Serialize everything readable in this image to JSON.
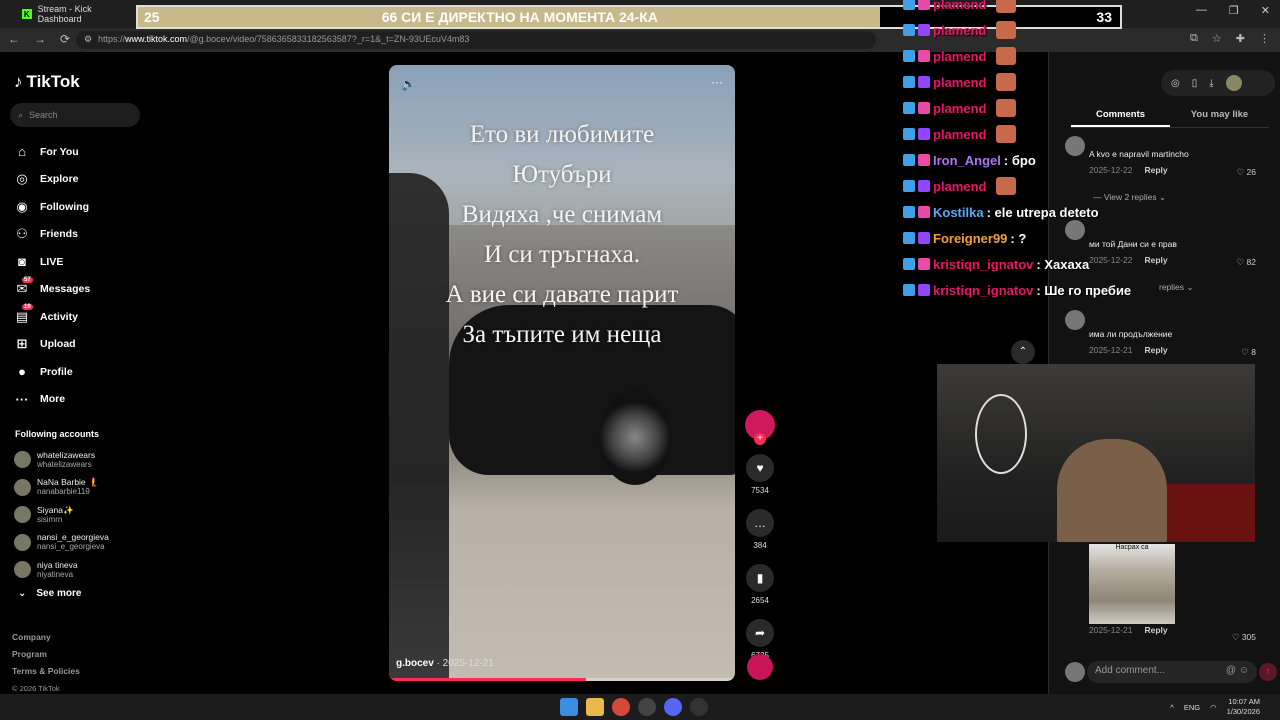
{
  "browser": {
    "tab_title": "Stream - Kick Dashboard",
    "url_host": "www.tiktok.com",
    "url_rest": "/@g.bocev/video/7586365833182563587?_r=1&_t=ZN-93UEcuV4m83",
    "url_scheme": "https://"
  },
  "banner": {
    "left_number": "25",
    "text": "66 СИ Е ДИРЕКТНО НА МОМЕНТА 24-КА",
    "right_number": "33"
  },
  "tiktok": {
    "logo": "TikTok",
    "search_placeholder": "Search",
    "nav": [
      {
        "label": "For You",
        "icon": "home-icon"
      },
      {
        "label": "Explore",
        "icon": "compass-icon"
      },
      {
        "label": "Following",
        "icon": "following-icon"
      },
      {
        "label": "Friends",
        "icon": "friends-icon"
      },
      {
        "label": "LIVE",
        "icon": "live-icon"
      },
      {
        "label": "Messages",
        "icon": "messages-icon",
        "badge": "57"
      },
      {
        "label": "Activity",
        "icon": "activity-icon",
        "badge": "19"
      },
      {
        "label": "Upload",
        "icon": "upload-icon"
      },
      {
        "label": "Profile",
        "icon": "profile-icon"
      },
      {
        "label": "More",
        "icon": "more-icon"
      }
    ],
    "following_title": "Following accounts",
    "following": [
      {
        "name": "whatelizawears",
        "handle": "whatelizawears"
      },
      {
        "name": "NaNa Barbie 🧜",
        "handle": "nanabarbie119"
      },
      {
        "name": "Siyana✨",
        "handle": "sisimrn"
      },
      {
        "name": "nansi_e_georgieva",
        "handle": "nansi_e_georgieva"
      },
      {
        "name": "niya tineva",
        "handle": "niyatineva"
      }
    ],
    "see_more": "See more",
    "footer": [
      "Company",
      "Program",
      "Terms & Policies"
    ],
    "copyright": "© 2026 TikTok"
  },
  "video": {
    "overlay_lines": [
      "Ето ви любимите",
      "Ютубъри",
      "Видяха ,че снимам",
      "И си тръгнаха.",
      "А вие си давате парит",
      "За тъпите им неща"
    ],
    "author": "g.bocev",
    "date": "· 2025-12-21",
    "progress": 0.57
  },
  "actions": {
    "likes": "7534",
    "comments": "384",
    "saves": "2654",
    "shares": "6725"
  },
  "comments_panel": {
    "tabs": [
      "Comments",
      "You may like"
    ],
    "comments": [
      {
        "text": "A kvo e napravil martincho",
        "date": "2025-12-22",
        "reply": "Reply",
        "likes": "26"
      },
      {
        "text": "ми той Дани си е прав",
        "date": "2025-12-22",
        "reply": "Reply",
        "likes": "82"
      },
      {
        "text": "има ли продължение",
        "date": "2025-12-21",
        "reply": "Reply",
        "likes": "8"
      },
      {
        "text": "",
        "date": "2025-12-21",
        "reply": "Reply",
        "likes": "305"
      }
    ],
    "view_replies_1": "View 2 replies",
    "view_replies_2": "replies",
    "meme_caption": "Насрах са",
    "comment_placeholder": "Add comment...",
    "at": "@",
    "emoji": "☺"
  },
  "chat": [
    {
      "user": "plamend",
      "msg": "",
      "color": "#e8156a",
      "emote": true
    },
    {
      "user": "plamend",
      "msg": "",
      "color": "#e8156a",
      "emote": true
    },
    {
      "user": "plamend",
      "msg": "",
      "color": "#e8156a",
      "emote": true
    },
    {
      "user": "plamend",
      "msg": "",
      "color": "#e8156a",
      "emote": true
    },
    {
      "user": "plamend",
      "msg": "",
      "color": "#e8156a",
      "emote": true
    },
    {
      "user": "plamend",
      "msg": "",
      "color": "#e8156a",
      "emote": true
    },
    {
      "user": "Iron_Angel",
      "msg": ": бро",
      "color": "#b074f0",
      "emote": false
    },
    {
      "user": "plamend",
      "msg": "",
      "color": "#e8156a",
      "emote": true
    },
    {
      "user": "Kostilka",
      "msg": ": ele utrepa deteto",
      "color": "#5aa8f5",
      "emote": false
    },
    {
      "user": "Foreigner99",
      "msg": ": ?",
      "color": "#f0a13c",
      "emote": false
    },
    {
      "user": "kristiqn_ignatov",
      "msg": ": Хахаха",
      "color": "#e8156a",
      "emote": false
    },
    {
      "user": "kristiqn_ignatov",
      "msg": ": Ше го пребие",
      "color": "#e8156a",
      "emote": false
    }
  ],
  "taskbar": {
    "lang": "ENG",
    "time": "10:07 AM",
    "date": "1/30/2026"
  }
}
